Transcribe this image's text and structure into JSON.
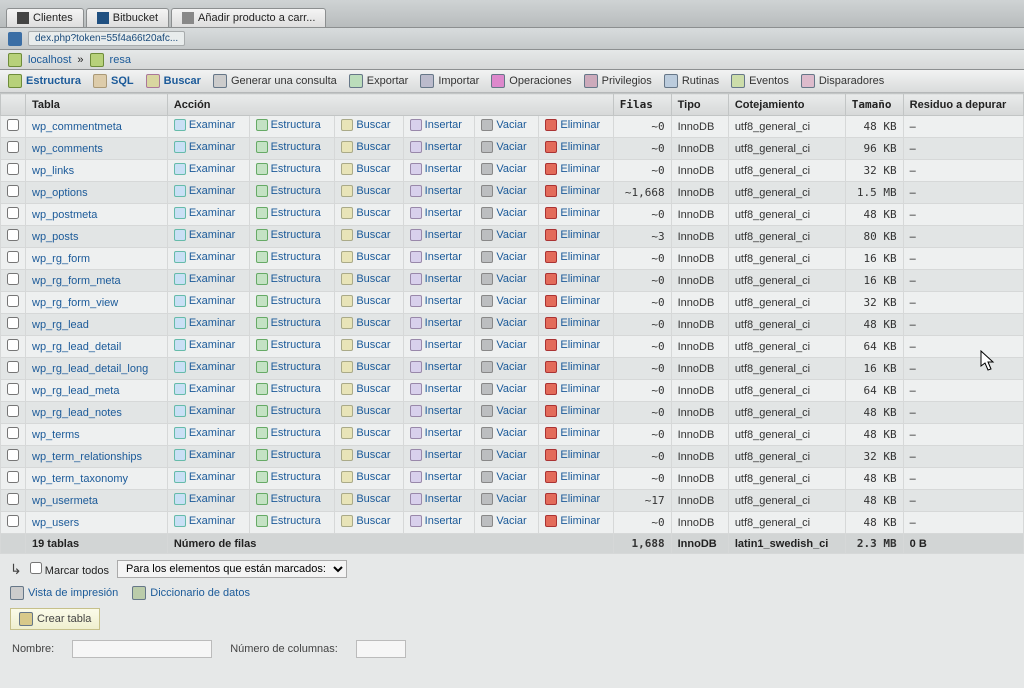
{
  "browser": {
    "url_fragment": "dex.php?token=55f4a66t20afc...",
    "tabs": [
      {
        "label": "Clientes"
      },
      {
        "label": "Bitbucket"
      },
      {
        "label": "Añadir producto a carr..."
      }
    ],
    "breadcrumb_host": "localhost",
    "breadcrumb_db": "resa"
  },
  "toolbar": {
    "structure": "Estructura",
    "sql": "SQL",
    "search": "Buscar",
    "generate_query": "Generar una consulta",
    "export": "Exportar",
    "import": "Importar",
    "operations": "Operaciones",
    "privileges": "Privilegios",
    "routines": "Rutinas",
    "events": "Eventos",
    "triggers": "Disparadores"
  },
  "headers": {
    "table": "Tabla",
    "action": "Acción",
    "rows": "Filas",
    "type": "Tipo",
    "collation": "Cotejamiento",
    "size": "Tamaño",
    "overhead": "Residuo a depurar"
  },
  "actions": {
    "browse": "Examinar",
    "structure": "Estructura",
    "search": "Buscar",
    "insert": "Insertar",
    "empty": "Vaciar",
    "drop": "Eliminar"
  },
  "tables": [
    {
      "name": "wp_commentmeta",
      "rows": "~0",
      "engine": "InnoDB",
      "collation": "utf8_general_ci",
      "size": "48 KB",
      "overhead": "–"
    },
    {
      "name": "wp_comments",
      "rows": "~0",
      "engine": "InnoDB",
      "collation": "utf8_general_ci",
      "size": "96 KB",
      "overhead": "–"
    },
    {
      "name": "wp_links",
      "rows": "~0",
      "engine": "InnoDB",
      "collation": "utf8_general_ci",
      "size": "32 KB",
      "overhead": "–"
    },
    {
      "name": "wp_options",
      "rows": "~1,668",
      "engine": "InnoDB",
      "collation": "utf8_general_ci",
      "size": "1.5 MB",
      "overhead": "–"
    },
    {
      "name": "wp_postmeta",
      "rows": "~0",
      "engine": "InnoDB",
      "collation": "utf8_general_ci",
      "size": "48 KB",
      "overhead": "–"
    },
    {
      "name": "wp_posts",
      "rows": "~3",
      "engine": "InnoDB",
      "collation": "utf8_general_ci",
      "size": "80 KB",
      "overhead": "–"
    },
    {
      "name": "wp_rg_form",
      "rows": "~0",
      "engine": "InnoDB",
      "collation": "utf8_general_ci",
      "size": "16 KB",
      "overhead": "–"
    },
    {
      "name": "wp_rg_form_meta",
      "rows": "~0",
      "engine": "InnoDB",
      "collation": "utf8_general_ci",
      "size": "16 KB",
      "overhead": "–"
    },
    {
      "name": "wp_rg_form_view",
      "rows": "~0",
      "engine": "InnoDB",
      "collation": "utf8_general_ci",
      "size": "32 KB",
      "overhead": "–"
    },
    {
      "name": "wp_rg_lead",
      "rows": "~0",
      "engine": "InnoDB",
      "collation": "utf8_general_ci",
      "size": "48 KB",
      "overhead": "–"
    },
    {
      "name": "wp_rg_lead_detail",
      "rows": "~0",
      "engine": "InnoDB",
      "collation": "utf8_general_ci",
      "size": "64 KB",
      "overhead": "–"
    },
    {
      "name": "wp_rg_lead_detail_long",
      "rows": "~0",
      "engine": "InnoDB",
      "collation": "utf8_general_ci",
      "size": "16 KB",
      "overhead": "–"
    },
    {
      "name": "wp_rg_lead_meta",
      "rows": "~0",
      "engine": "InnoDB",
      "collation": "utf8_general_ci",
      "size": "64 KB",
      "overhead": "–"
    },
    {
      "name": "wp_rg_lead_notes",
      "rows": "~0",
      "engine": "InnoDB",
      "collation": "utf8_general_ci",
      "size": "48 KB",
      "overhead": "–"
    },
    {
      "name": "wp_terms",
      "rows": "~0",
      "engine": "InnoDB",
      "collation": "utf8_general_ci",
      "size": "48 KB",
      "overhead": "–"
    },
    {
      "name": "wp_term_relationships",
      "rows": "~0",
      "engine": "InnoDB",
      "collation": "utf8_general_ci",
      "size": "32 KB",
      "overhead": "–"
    },
    {
      "name": "wp_term_taxonomy",
      "rows": "~0",
      "engine": "InnoDB",
      "collation": "utf8_general_ci",
      "size": "48 KB",
      "overhead": "–"
    },
    {
      "name": "wp_usermeta",
      "rows": "~17",
      "engine": "InnoDB",
      "collation": "utf8_general_ci",
      "size": "48 KB",
      "overhead": "–"
    },
    {
      "name": "wp_users",
      "rows": "~0",
      "engine": "InnoDB",
      "collation": "utf8_general_ci",
      "size": "48 KB",
      "overhead": "–"
    }
  ],
  "summary": {
    "count_label": "19 tablas",
    "rows_label": "Número de filas",
    "rows_total": "1,688",
    "engine": "InnoDB",
    "collation": "latin1_swedish_ci",
    "size": "2.3 MB",
    "overhead": "0 B"
  },
  "below": {
    "check_all": "Marcar todos",
    "with_selected_placeholder": "Para los elementos que están marcados:"
  },
  "footer_links": {
    "print_view": "Vista de impresión",
    "data_dictionary": "Diccionario de datos"
  },
  "create": {
    "button": "Crear tabla",
    "name_label": "Nombre:",
    "cols_label": "Número de columnas:"
  }
}
